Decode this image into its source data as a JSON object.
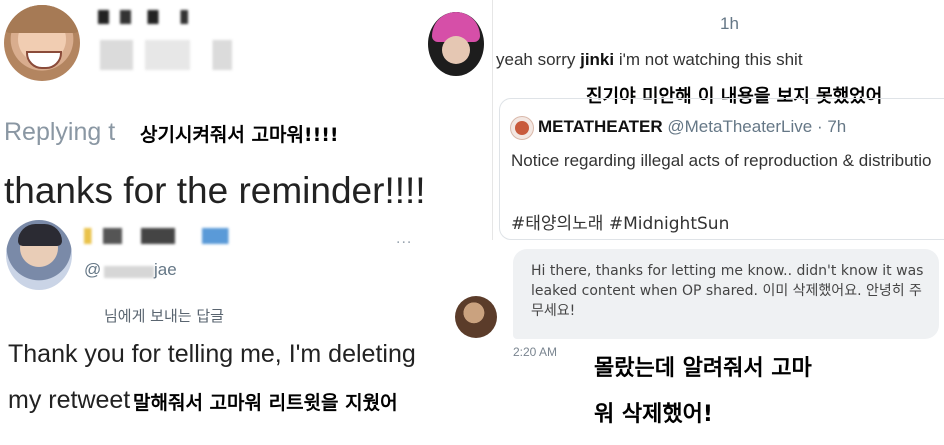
{
  "left_top": {
    "replying_label": "Replying t",
    "replying_caption": "상기시켜줘서 고마워!!!!",
    "tweet_text": "thanks for the reminder!!!!"
  },
  "left_bottom": {
    "handle_fragment": "@",
    "handle_tail": "jae",
    "more_icon_label": "...",
    "reply_note": "님에게 보내는 답글",
    "reply_line1": "Thank you for telling me, I'm deleting",
    "reply_line2": "my retweet",
    "caption": "말해줘서 고마워 리트윗을 지웠어"
  },
  "right_top": {
    "time": "1h",
    "text_prefix": "yeah sorry ",
    "text_bold": "jinki",
    "text_suffix": " i'm not watching this shit",
    "caption": "진기야 미안해 이 내용을 보지 못했었어",
    "quote": {
      "name": "METATHEATER",
      "handle": "@MetaTheaterLive",
      "time": "· 7h",
      "text": "Notice regarding illegal acts of reproduction & distributio",
      "tags": "#태양의노래 #MidnightSun"
    }
  },
  "right_bottom": {
    "message": "Hi there, thanks for letting me know.. didn't know it was leaked content when OP shared. 이미 삭제했어요. 안녕히 주무세요!",
    "time": "2:20 AM",
    "caption_line1": "몰랐는데 알려줘서 고마",
    "caption_line2": "워 삭제했어!"
  },
  "colors": {
    "twitter_gray": "#657786",
    "divider": "#e6e6e6",
    "bubble": "#eff1f3",
    "avatar_cat_pink": "#d64fa8"
  }
}
